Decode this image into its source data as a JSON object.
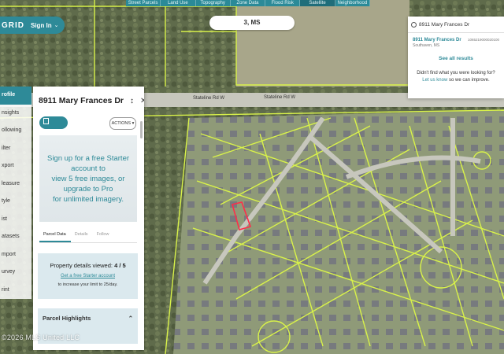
{
  "topbar": {
    "tabs": [
      "Street Parcels",
      "Land Use",
      "Topography",
      "Zone Data",
      "Flood Risk",
      "Satellite",
      "Neighborhood"
    ],
    "active_index": 5
  },
  "brand": {
    "logo": "GRID",
    "signin": "Sign In",
    "chevron": "⌄"
  },
  "location_pill": "3, MS",
  "map_labels": {
    "road1": "Stateline Rd W",
    "road2": "Stateline Rd W"
  },
  "sidebar": {
    "items": [
      "rofile",
      "nsights",
      "ollowing",
      "ilter",
      "xport",
      "leasure",
      "tyle",
      "ist",
      "atasets",
      "mport",
      "urvey",
      "rint"
    ],
    "active_index": 0
  },
  "panel": {
    "title": "8911 Mary Frances Dr",
    "follow_label": "FOLLOW",
    "actions_label": "ACTIONS ▾",
    "promo_lines": [
      "Sign up for a free Starter account to",
      "view 5 free images, or upgrade to Pro",
      "for unlimited imagery."
    ],
    "tabs": [
      "Parcel Data",
      "Details",
      "Follow"
    ],
    "viewed_label": "Property details viewed: ",
    "viewed_value": "4 / 5",
    "viewed_link": "Get a free Starter account",
    "viewed_note": "to increase your limit to 25/day.",
    "highlights_title": "Parcel Highlights"
  },
  "search": {
    "query": "8911 Mary Frances Dr",
    "result_address": "8911 Mary Frances Dr",
    "result_id": "1065219000020100",
    "result_city": "Southaven, MS",
    "see_all": "See all results",
    "not_found": "Didn't find what you were looking for?",
    "let_us_know": "Let us know",
    "improve": " so we can improve."
  },
  "watermark": "©2026 MLS United LLC",
  "colors": {
    "teal": "#2e8a98",
    "parcel": "#d9f24a",
    "road": "#c7c7bd",
    "highlight": "#ff2d4a"
  }
}
